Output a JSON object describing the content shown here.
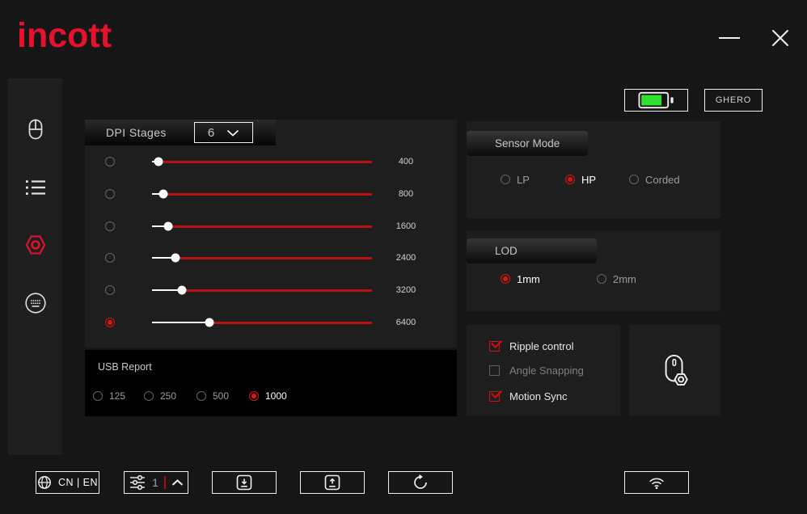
{
  "brand": {
    "logo": "incott"
  },
  "header": {
    "battery_percent": 80,
    "device_name": "GHERO"
  },
  "sidebar": {
    "items": [
      {
        "id": "mouse-buttons",
        "active": false
      },
      {
        "id": "key-settings",
        "active": false
      },
      {
        "id": "sensor-settings",
        "active": true
      },
      {
        "id": "macro-settings",
        "active": false
      }
    ]
  },
  "dpi": {
    "title": "DPI Stages",
    "stage_count": "6",
    "stages": [
      {
        "value": "400",
        "selected": false,
        "track_percent": 3
      },
      {
        "value": "800",
        "selected": false,
        "track_percent": 5
      },
      {
        "value": "1600",
        "selected": false,
        "track_percent": 7.5
      },
      {
        "value": "2400",
        "selected": false,
        "track_percent": 10.5
      },
      {
        "value": "3200",
        "selected": false,
        "track_percent": 13.5
      },
      {
        "value": "6400",
        "selected": true,
        "track_percent": 26
      }
    ]
  },
  "usb_report": {
    "title": "USB Report",
    "options": [
      {
        "label": "125",
        "selected": false
      },
      {
        "label": "250",
        "selected": false
      },
      {
        "label": "500",
        "selected": false
      },
      {
        "label": "1000",
        "selected": true
      }
    ]
  },
  "sensor_mode": {
    "title": "Sensor Mode",
    "options": [
      {
        "label": "LP",
        "selected": false
      },
      {
        "label": "HP",
        "selected": true
      },
      {
        "label": "Corded",
        "selected": false
      }
    ]
  },
  "lod": {
    "title": "LOD",
    "options": [
      {
        "label": "1mm",
        "selected": true
      },
      {
        "label": "2mm",
        "selected": false
      }
    ]
  },
  "toggles": [
    {
      "label": "Ripple control",
      "checked": true
    },
    {
      "label": "Angle Snapping",
      "checked": false
    },
    {
      "label": "Motion Sync",
      "checked": true
    }
  ],
  "footer": {
    "language": "CN | EN",
    "profile": "1"
  },
  "colors": {
    "accent_red": "#e8112d",
    "slider_red": "#b81111",
    "battery_green": "#2fe02f",
    "panel_bg": "#1e1e1e"
  }
}
